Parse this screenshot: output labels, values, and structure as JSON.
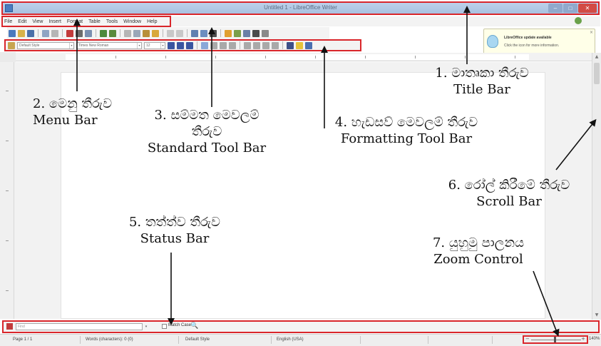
{
  "window": {
    "title": "Untitled 1 - LibreOffice Writer",
    "minimize": "–",
    "maximize": "□",
    "close": "✕"
  },
  "menubar": {
    "items": [
      "File",
      "Edit",
      "View",
      "Insert",
      "Format",
      "Table",
      "Tools",
      "Window",
      "Help"
    ]
  },
  "formatting": {
    "style": "Default Style",
    "font": "Times New Roman",
    "size": "12"
  },
  "update_notice": {
    "title": "LibreOffice update available",
    "body": "Click the icon for more information.",
    "close": "×"
  },
  "findbar": {
    "placeholder": "Find",
    "match_case": "Match Case"
  },
  "statusbar": {
    "page": "Page 1 / 1",
    "words": "Words (characters): 0 (0)",
    "style": "Default Style",
    "language": "English (USA)",
    "zoom": "140%"
  },
  "labels": {
    "title_bar": {
      "si": "1. මාතෘකා තීරුව",
      "en": "Title Bar"
    },
    "menu_bar": {
      "si": "2. මෙනු තීරුව",
      "en": "Menu Bar"
    },
    "standard_toolbar": {
      "si1": "3. සම්මත මෙවලම්",
      "si2": "තීරුව",
      "en": "Standard Tool Bar"
    },
    "formatting_toolbar": {
      "si": "4. හැඩසව් මෙවලම් තීරුව",
      "en": "Formatting Tool Bar"
    },
    "status_bar": {
      "si": "5. තත්ත්ව තීරුව",
      "en": "Status Bar"
    },
    "scroll_bar": {
      "si": "6. රෝල් කිරීමේ තීරුව",
      "en": "Scroll Bar"
    },
    "zoom_control": {
      "si": "7. යුහුමු පාලනය",
      "en": "Zoom Control"
    }
  },
  "colors": {
    "highlight": "#d9262b",
    "titlebar": "#bcd1ea",
    "annotation_text": "#111111"
  }
}
